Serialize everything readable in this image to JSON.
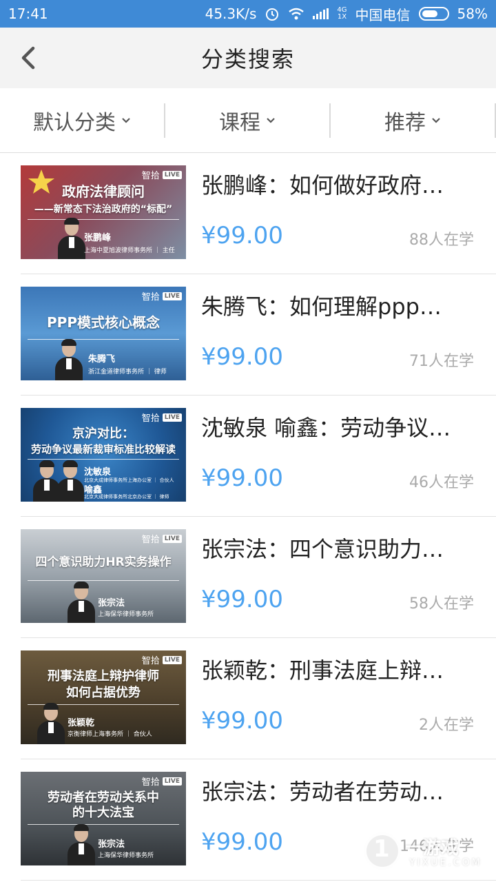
{
  "status_bar": {
    "time": "17:41",
    "speed": "45.3K/s",
    "network_top": "4G",
    "network_bottom": "1X",
    "carrier": "中国电信",
    "battery": "58%"
  },
  "header": {
    "title": "分类搜索",
    "back_icon": "chevron-left-icon"
  },
  "filters": [
    {
      "label": "默认分类",
      "icon": "chevron-down-icon"
    },
    {
      "label": "课程",
      "icon": "chevron-down-icon"
    },
    {
      "label": "推荐",
      "icon": "chevron-down-icon"
    }
  ],
  "thumb_brand": {
    "text": "智拾",
    "badge": "LIVE"
  },
  "courses": [
    {
      "title": "张鹏峰：如何做好政府…",
      "price": "¥99.00",
      "students": "88人在学",
      "thumb_caption": [
        "政府法律顾问",
        "——新常态下法治政府的“标配”"
      ],
      "thumb_name": "张鹏峰",
      "thumb_firm": "上海中夏旭波律师事务所 ｜ 主任"
    },
    {
      "title": "朱腾飞：如何理解ppp…",
      "price": "¥99.00",
      "students": "71人在学",
      "thumb_caption": [
        "PPP模式核心概念"
      ],
      "thumb_name": "朱腾飞",
      "thumb_firm": "浙江金道律师事务所 ｜ 律师"
    },
    {
      "title": "沈敏泉 喻鑫：劳动争议…",
      "price": "¥99.00",
      "students": "46人在学",
      "thumb_caption": [
        "京沪对比：",
        "劳动争议最新裁审标准比较解读"
      ],
      "thumb_name": "沈敏泉",
      "thumb_name2": "喻鑫",
      "thumb_firm": "北京大成律师事务所上海办公室 ｜ 合伙人",
      "thumb_firm2": "北京大成律师事务所北京办公室 ｜ 律师"
    },
    {
      "title": "张宗法：四个意识助力…",
      "price": "¥99.00",
      "students": "58人在学",
      "thumb_caption": [
        "四个意识助力HR实务操作"
      ],
      "thumb_name": "张宗法",
      "thumb_firm": "上海保华律师事务所"
    },
    {
      "title": "张颖乾：刑事法庭上辩…",
      "price": "¥99.00",
      "students": "2人在学",
      "thumb_caption": [
        "刑事法庭上辩护律师",
        "如何占据优势"
      ],
      "thumb_name": "张颖乾",
      "thumb_firm": "京衡律师上海事务所 ｜ 合伙人"
    },
    {
      "title": "张宗法：劳动者在劳动…",
      "price": "¥99.00",
      "students": "146人在学",
      "thumb_caption": [
        "劳动者在劳动关系中",
        "的十大法宝"
      ],
      "thumb_name": "张宗法",
      "thumb_firm": "上海保华律师事务所"
    }
  ],
  "watermark": {
    "number": "1",
    "text": "一游戏",
    "domain": "YIXUE.COM"
  },
  "colors": {
    "status_bar": "#3f8ad6",
    "price": "#4da3f0",
    "students": "#aaaaaa",
    "title_bar": "#f3f3f3"
  }
}
